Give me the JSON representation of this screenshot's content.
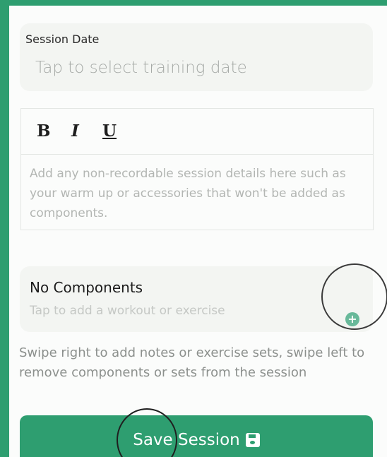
{
  "session_date": {
    "label": "Session Date",
    "placeholder": "Tap to select training date"
  },
  "editor": {
    "toolbar": {
      "bold": "B",
      "italic": "I",
      "underline": "U"
    },
    "placeholder": "Add any non-recordable session details here such as your warm up or accessories that won't be added as components."
  },
  "components": {
    "title": "No Components",
    "subtitle": "Tap to add a workout or exercise",
    "add_icon": "plus-circle-icon"
  },
  "help_text": "Swipe right to add notes or exercise sets, swipe left to remove components or sets from the session",
  "save_button": {
    "label": "Save Session",
    "icon": "floppy-disk-icon"
  },
  "colors": {
    "accent": "#2e9e70",
    "card_bg": "#f3f5f2"
  }
}
